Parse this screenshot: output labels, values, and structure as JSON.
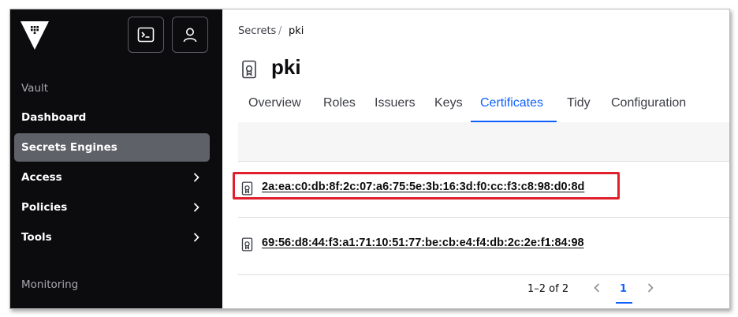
{
  "sidebar": {
    "logo": "vault-logo",
    "terminal_button_icon": "terminal-icon",
    "user_button_icon": "user-icon",
    "section_vault": "Vault",
    "items": [
      {
        "label": "Dashboard",
        "active": false,
        "has_chevron": false
      },
      {
        "label": "Secrets Engines",
        "active": true,
        "has_chevron": false
      },
      {
        "label": "Access",
        "active": false,
        "has_chevron": true
      },
      {
        "label": "Policies",
        "active": false,
        "has_chevron": true
      },
      {
        "label": "Tools",
        "active": false,
        "has_chevron": true
      }
    ],
    "section_monitoring": "Monitoring"
  },
  "breadcrumb": {
    "root": "Secrets",
    "separator": "/",
    "current": "pki"
  },
  "page": {
    "title": "pki",
    "title_icon": "certificate-icon"
  },
  "tabs": [
    {
      "label": "Overview",
      "active": false
    },
    {
      "label": "Roles",
      "active": false
    },
    {
      "label": "Issuers",
      "active": false
    },
    {
      "label": "Keys",
      "active": false
    },
    {
      "label": "Certificates",
      "active": true
    },
    {
      "label": "Tidy",
      "active": false
    },
    {
      "label": "Configuration",
      "active": false
    }
  ],
  "certificates": [
    {
      "serial": "2a:ea:c0:db:8f:2c:07:a6:75:5e:3b:16:3d:f0:cc:f3:c8:98:d0:8d",
      "highlighted": true
    },
    {
      "serial": "69:56:d8:44:f3:a1:71:10:51:77:be:cb:e4:f4:db:2c:2e:f1:84:98",
      "highlighted": false
    }
  ],
  "pagination": {
    "range": "1–2 of 2",
    "current_page": "1"
  },
  "colors": {
    "sidebar_bg": "#0c0c0e",
    "active_nav_bg": "#5f6168",
    "accent": "#1060ff",
    "highlight": "#e01e2c"
  }
}
